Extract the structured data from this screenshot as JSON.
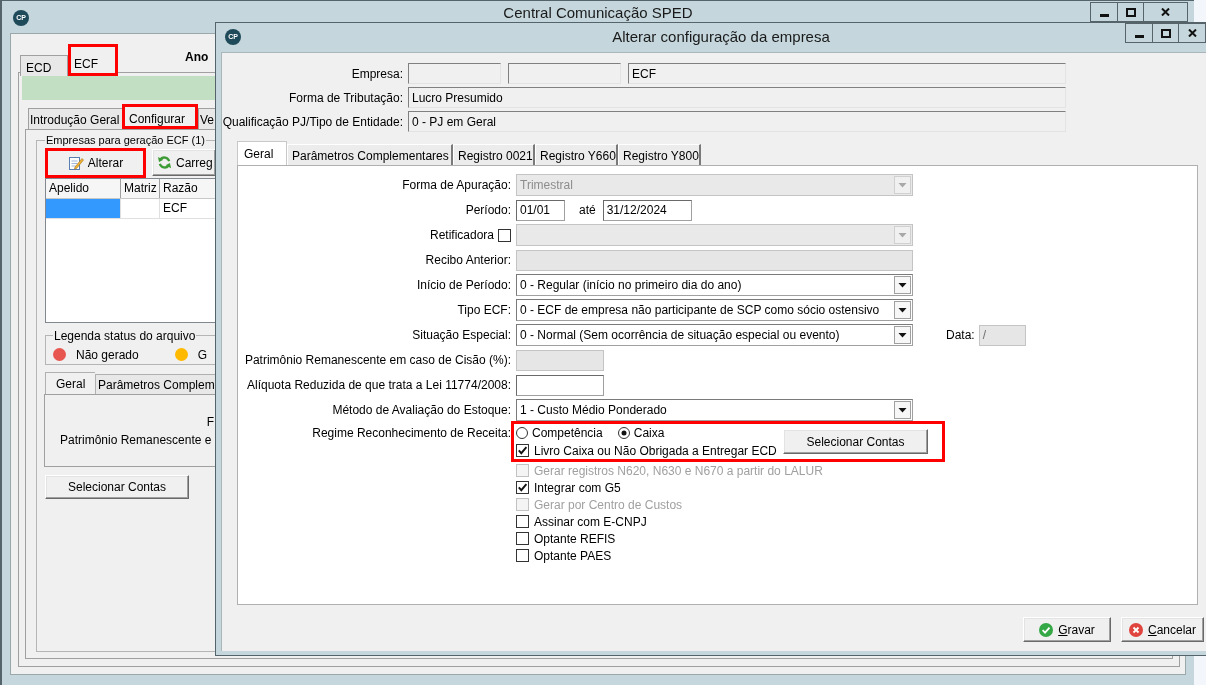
{
  "main_window": {
    "logo": "CP",
    "title": "Central Comunicação SPED",
    "tabs": [
      {
        "label": "ECD",
        "selected": false,
        "highlighted": false
      },
      {
        "label": "ECF",
        "selected": true,
        "highlighted": true
      }
    ],
    "year_label": "Ano",
    "subtabs": [
      {
        "label": "Introdução Geral",
        "selected": false,
        "highlighted": false
      },
      {
        "label": "Configurar",
        "selected": true,
        "highlighted": true
      },
      {
        "label": "Ve",
        "selected": false,
        "highlighted": false
      }
    ],
    "companies": {
      "title": "Empresas para geração ECF (1)",
      "buttons": [
        {
          "kind": "edit",
          "label": "Alterar",
          "highlighted": true
        },
        {
          "kind": "reload",
          "label": "Carreg",
          "highlighted": false
        }
      ],
      "table": {
        "columns": [
          "Apelido",
          "Matriz",
          "Razão"
        ],
        "rows": [
          {
            "selected": true,
            "razao": "ECF"
          }
        ]
      }
    },
    "legend": {
      "title": "Legenda status do arquivo",
      "items": [
        {
          "label": "Não gerado",
          "color": "#e8574f"
        },
        {
          "label": "G",
          "color": "#ffb900"
        }
      ]
    },
    "detail_tabs": [
      {
        "label": "Geral",
        "selected": true
      },
      {
        "label": "Parâmetros Complem",
        "selected": false
      }
    ],
    "detail_texts": [
      "F",
      "Patrimônio Remanescente e"
    ],
    "select_accounts_button": "Selecionar Contas"
  },
  "dialog": {
    "logo": "CP",
    "title": "Alterar configuração da empresa",
    "company": {
      "label": "Empresa:",
      "name": "ECF"
    },
    "taxation": {
      "label": "Forma de Tributação:",
      "value": "Lucro Presumido"
    },
    "qualification": {
      "label": "Qualificação PJ/Tipo de Entidade:",
      "value": "0 - PJ em Geral"
    },
    "tabs": [
      {
        "label": "Geral",
        "selected": true
      },
      {
        "label": "Parâmetros Complementares",
        "selected": false
      },
      {
        "label": "Registro 0021",
        "selected": false
      },
      {
        "label": "Registro Y660",
        "selected": false
      },
      {
        "label": "Registro Y800",
        "selected": false
      }
    ],
    "form_rows": [
      {
        "kind": "select",
        "label": "Forma de Apuração:",
        "value": "Trimestral",
        "disabled": true
      },
      {
        "kind": "period",
        "label": "Período:",
        "start": "01/01",
        "to_label": "até",
        "end": "31/12/2024"
      },
      {
        "kind": "select",
        "label": "Retificadora",
        "checked": false,
        "disabled": true
      },
      {
        "kind": "input",
        "label": "Recibo Anterior:",
        "disabled": true
      },
      {
        "kind": "select",
        "label": "Início de Período:",
        "value": "0 - Regular (início no primeiro dia do ano)",
        "disabled": false
      },
      {
        "kind": "select",
        "label": "Tipo ECF:",
        "value": "0 - ECF de empresa não participante de SCP como sócio ostensivo",
        "disabled": false
      },
      {
        "kind": "select",
        "label": "Situação Especial:",
        "value": "0 - Normal (Sem ocorrência de situação especial ou evento)",
        "disabled": false,
        "date": {
          "label": "Data:",
          "value": "/",
          "disabled": true
        }
      },
      {
        "kind": "numeric",
        "label": "Patrimônio Remanescente em caso de Cisão (%):",
        "disabled": true
      },
      {
        "kind": "numeric",
        "label": "Alíquota Reduzida de que trata a Lei 11774/2008:",
        "disabled": false
      },
      {
        "kind": "select",
        "label": "Método de Avaliação do Estoque:",
        "value": "1 - Custo Médio Ponderado",
        "disabled": false
      }
    ],
    "regime": {
      "label": "Regime Reconhecimento de Receita:",
      "highlighted": true,
      "options": [
        {
          "label": "Competência",
          "selected": false
        },
        {
          "label": "Caixa",
          "selected": true
        }
      ],
      "cash_book": {
        "label": "Livro Caixa ou Não Obrigada a Entregar ECD",
        "checked": true
      },
      "select_accounts_button": "Selecionar Contas"
    },
    "checkboxes": [
      {
        "label": "Gerar registros N620, N630 e N670 a partir do LALUR",
        "checked": false,
        "disabled": true
      },
      {
        "label": "Integrar com G5",
        "checked": true,
        "disabled": false
      },
      {
        "label": "Gerar por Centro de Custos",
        "checked": false,
        "disabled": true
      },
      {
        "label": "Assinar com E-CNPJ",
        "checked": false,
        "disabled": false
      },
      {
        "label": "Optante REFIS",
        "checked": false,
        "disabled": false
      },
      {
        "label": "Optante PAES",
        "checked": false,
        "disabled": false
      }
    ],
    "buttons": [
      {
        "kind": "save",
        "label": "Gravar"
      },
      {
        "kind": "cancel",
        "label": "Cancelar"
      }
    ]
  }
}
